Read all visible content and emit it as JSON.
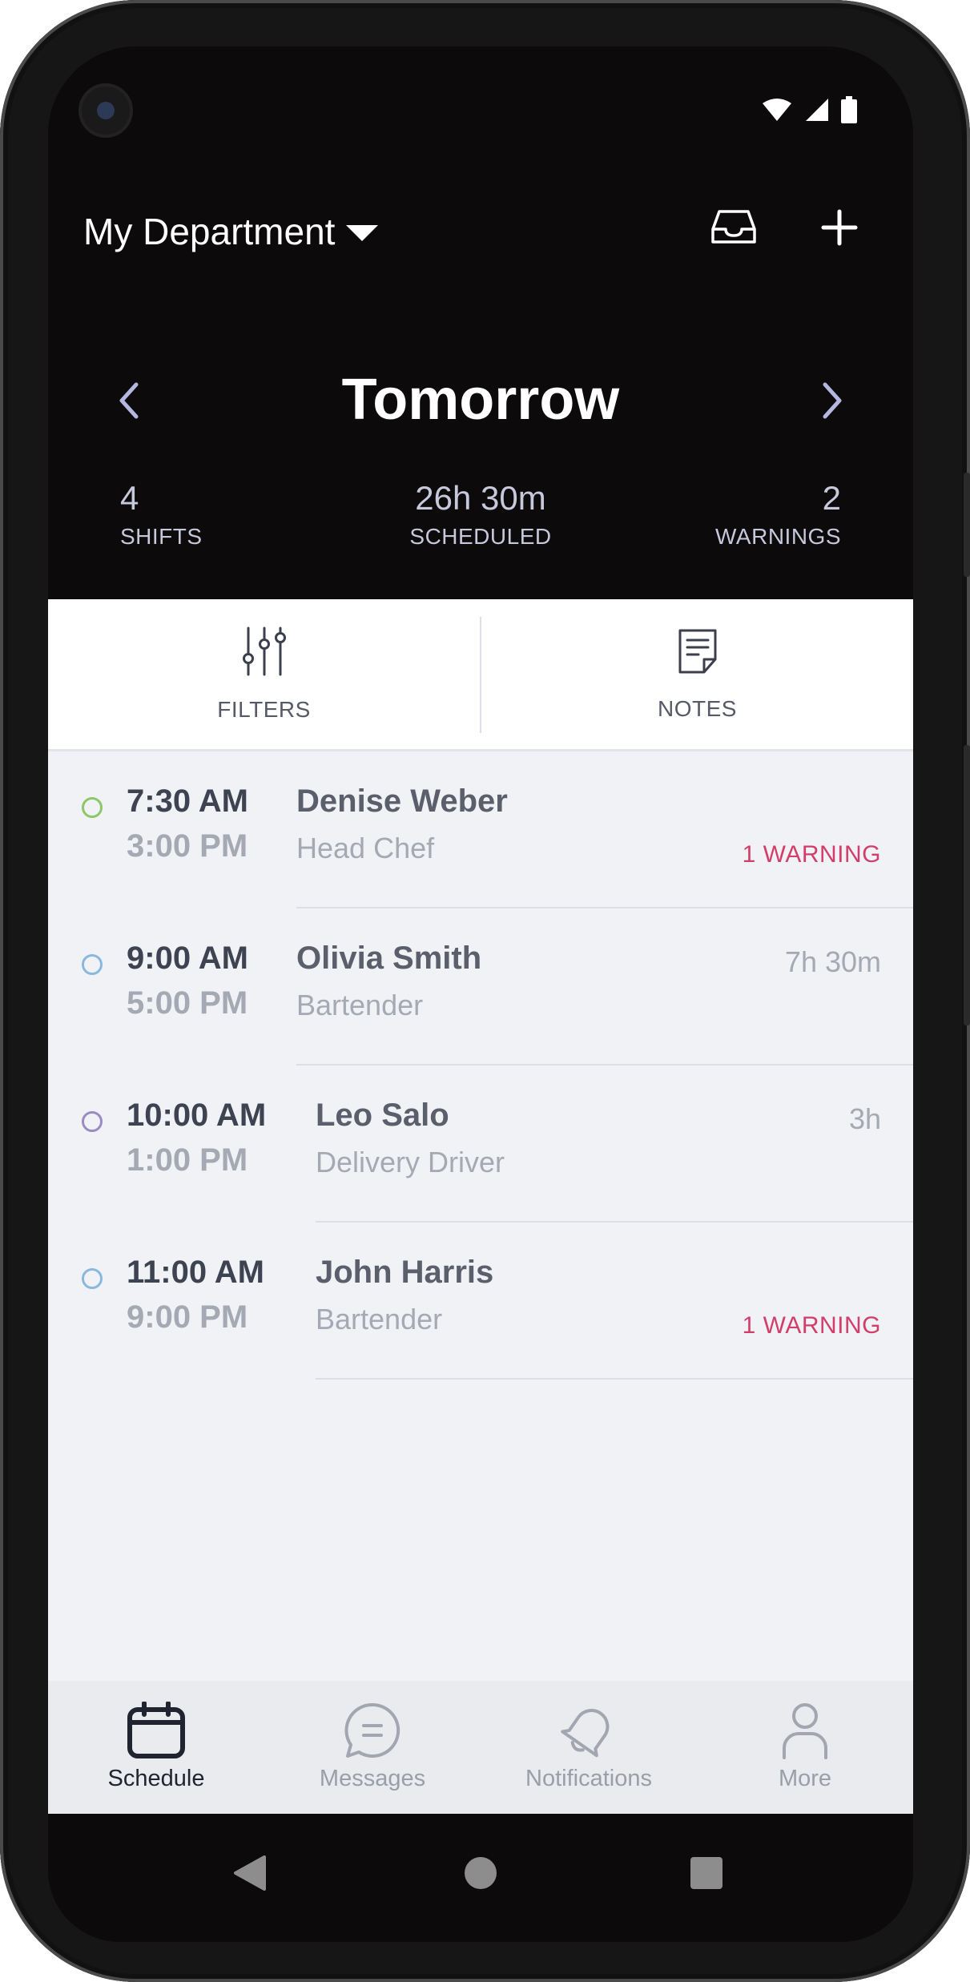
{
  "header": {
    "department": "My Department",
    "day_title": "Tomorrow",
    "stats": {
      "shifts_value": "4",
      "shifts_label": "SHIFTS",
      "scheduled_value": "26h 30m",
      "scheduled_label": "SCHEDULED",
      "warnings_value": "2",
      "warnings_label": "WARNINGS"
    }
  },
  "toolbar": {
    "filters_label": "FILTERS",
    "notes_label": "NOTES"
  },
  "shifts": [
    {
      "start": "7:30 AM",
      "end": "3:00 PM",
      "name": "Denise Weber",
      "role": "Head Chef",
      "meta": "1 WARNING",
      "meta_type": "warning",
      "dot_color": "#8cc76a"
    },
    {
      "start": "9:00 AM",
      "end": "5:00 PM",
      "name": "Olivia Smith",
      "role": "Bartender",
      "meta": "7h 30m",
      "meta_type": "duration",
      "dot_color": "#8ab8dc"
    },
    {
      "start": "10:00 AM",
      "end": "1:00 PM",
      "name": "Leo Salo",
      "role": "Delivery Driver",
      "meta": "3h",
      "meta_type": "duration",
      "dot_color": "#9a8cc0"
    },
    {
      "start": "11:00 AM",
      "end": "9:00 PM",
      "name": "John Harris",
      "role": "Bartender",
      "meta": "1 WARNING",
      "meta_type": "warning",
      "dot_color": "#8ab8dc"
    }
  ],
  "bottom_nav": {
    "schedule": "Schedule",
    "messages": "Messages",
    "notifications": "Notifications",
    "more": "More"
  },
  "colors": {
    "header_bg": "#0c0a0a",
    "list_bg": "#f1f2f6",
    "warning": "#d23e6a"
  },
  "icons": {
    "status": [
      "wifi-icon",
      "cellular-signal-icon",
      "battery-icon"
    ],
    "header": [
      "dropdown-caret-icon",
      "inbox-icon",
      "plus-icon",
      "chevron-left-icon",
      "chevron-right-icon"
    ],
    "toolbar": [
      "sliders-icon",
      "notes-icon"
    ],
    "bottom_nav": [
      "calendar-icon",
      "message-icon",
      "bell-icon",
      "person-icon"
    ],
    "system": [
      "back-icon",
      "home-icon",
      "recents-icon"
    ]
  }
}
